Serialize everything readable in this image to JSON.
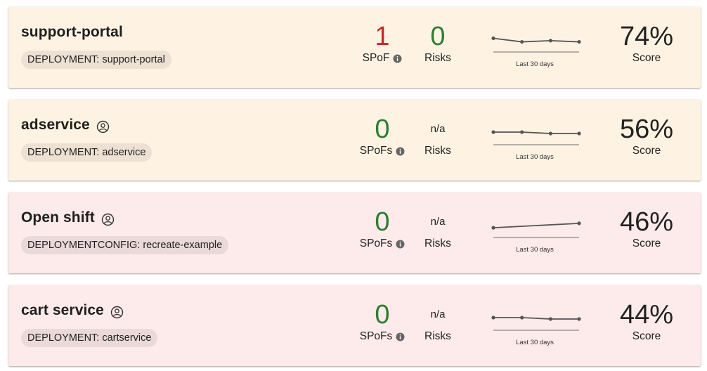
{
  "cards": [
    {
      "title": "support-portal",
      "has_owner_icon": false,
      "tag": "DEPLOYMENT: support-portal",
      "status": "warn",
      "spof_value": "1",
      "spof_color": "#c62828",
      "spof_label": "SPoF",
      "risks_value": "0",
      "risks_is_na": false,
      "risks_label": "Risks",
      "trend_caption": "Last 30 days",
      "trend": [
        0.74,
        0.71,
        0.72,
        0.71
      ],
      "score": "74%",
      "score_label": "Score"
    },
    {
      "title": "adservice",
      "has_owner_icon": true,
      "tag": "DEPLOYMENT: adservice",
      "status": "warn",
      "spof_value": "0",
      "spof_color": "#2e7d32",
      "spof_label": "SPoFs",
      "risks_value": "n/a",
      "risks_is_na": true,
      "risks_label": "Risks",
      "trend_caption": "Last 30 days",
      "trend": [
        0.57,
        0.57,
        0.56,
        0.56
      ],
      "score": "56%",
      "score_label": "Score"
    },
    {
      "title": "Open shift",
      "has_owner_icon": true,
      "tag": "DEPLOYMENTCONFIG: recreate-example",
      "status": "crit",
      "spof_value": "0",
      "spof_color": "#2e7d32",
      "spof_label": "SPoFs",
      "risks_value": "n/a",
      "risks_is_na": true,
      "risks_label": "Risks",
      "trend_caption": "Last 30 days",
      "trend": [
        0.42,
        0.46
      ],
      "score": "46%",
      "score_label": "Score"
    },
    {
      "title": "cart service",
      "has_owner_icon": true,
      "tag": "DEPLOYMENT: cartservice",
      "status": "crit",
      "spof_value": "0",
      "spof_color": "#2e7d32",
      "spof_label": "SPoFs",
      "risks_value": "n/a",
      "risks_is_na": true,
      "risks_label": "Risks",
      "trend_caption": "Last 30 days",
      "trend": [
        0.45,
        0.45,
        0.44,
        0.44
      ],
      "score": "44%",
      "score_label": "Score"
    }
  ],
  "colors": {
    "warn_bg": "#fef3e2",
    "crit_bg": "#fdeaea",
    "green": "#2e7d32",
    "red": "#c62828"
  },
  "icons": {
    "owner": "person-circle-icon",
    "info": "info-icon"
  }
}
